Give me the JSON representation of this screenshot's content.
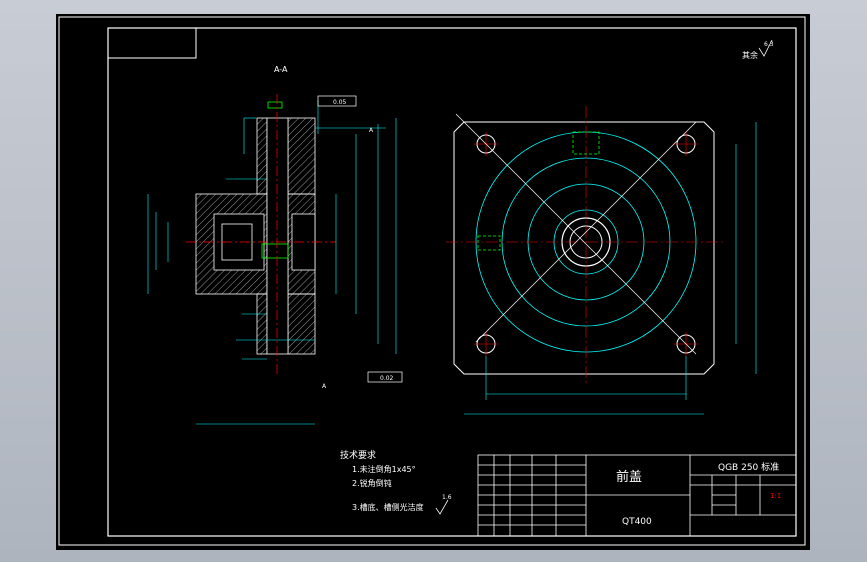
{
  "drawing": {
    "section_label": "A-A",
    "roughness_other": "其余",
    "roughness_other_value": "6.3",
    "datum_a": "A",
    "datum_a_bottom": "A",
    "tolerance_1": "0.05",
    "tolerance_2": "0.02"
  },
  "requirements": {
    "title": "技术要求",
    "item1": "1.未注倒角1x45°",
    "item2": "2.锐角倒钝",
    "item3": "3.槽底、槽侧光洁度",
    "item3_value": "1.6"
  },
  "titleblock": {
    "part_name": "前盖",
    "material": "QT400",
    "project": "QGB 250 标准",
    "scale": "1:1"
  },
  "colors": {
    "background": "#000000",
    "outline": "#ffffff",
    "dimension": "#00ffff",
    "hidden": "#00ff00",
    "center": "#ff0000",
    "hatch": "#ffffff"
  }
}
